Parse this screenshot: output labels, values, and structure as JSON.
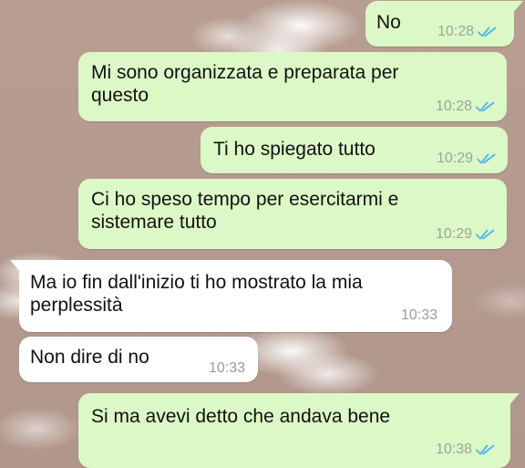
{
  "messages": [
    {
      "direction": "outgoing",
      "lines": [
        "No"
      ],
      "time": "10:28",
      "status": "read"
    },
    {
      "direction": "outgoing",
      "lines": [
        "Mi sono organizzata e preparata per",
        "questo"
      ],
      "time": "10:28",
      "status": "read"
    },
    {
      "direction": "outgoing",
      "lines": [
        "Ti ho spiegato tutto"
      ],
      "time": "10:29",
      "status": "read"
    },
    {
      "direction": "outgoing",
      "lines": [
        "Ci ho speso tempo per esercitarmi e",
        "sistemare tutto"
      ],
      "time": "10:29",
      "status": "read"
    },
    {
      "direction": "incoming",
      "lines": [
        "Ma io fin dall'inizio ti ho mostrato la mia",
        "perplessità"
      ],
      "time": "10:33"
    },
    {
      "direction": "incoming",
      "lines": [
        "Non dire di no"
      ],
      "time": "10:33"
    },
    {
      "direction": "outgoing",
      "lines": [
        "Si ma avevi detto che andava bene"
      ],
      "time": "10:38",
      "status": "read"
    }
  ],
  "colors": {
    "outgoing_bubble": "#dcf8c6",
    "incoming_bubble": "#ffffff",
    "read_ticks": "#4fb6ec",
    "wallpaper": "#b49a8f"
  },
  "icons": {
    "read_receipt": "double-check-icon"
  }
}
